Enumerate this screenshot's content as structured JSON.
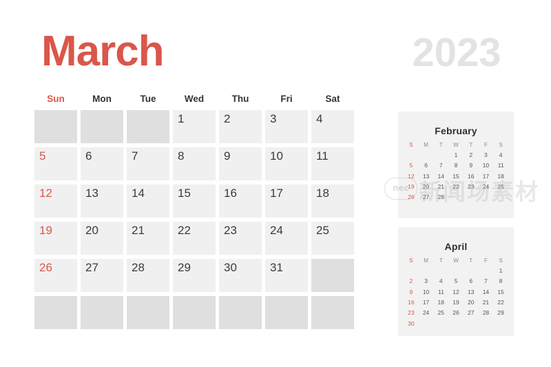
{
  "year": "2023",
  "month_title": "March",
  "colors": {
    "accent_red": "#d9574a",
    "text_dark": "#333333",
    "cell_filled": "#f0f0f0",
    "cell_empty": "#dfdfdf",
    "year_gray": "#e2e4e3",
    "mini_panel_bg": "#f2f2f2"
  },
  "main": {
    "weekdays": [
      "Sun",
      "Mon",
      "Tue",
      "Wed",
      "Thu",
      "Fri",
      "Sat"
    ],
    "weeks": [
      [
        "",
        "",
        "",
        "1",
        "2",
        "3",
        "4"
      ],
      [
        "5",
        "6",
        "7",
        "8",
        "9",
        "10",
        "11"
      ],
      [
        "12",
        "13",
        "14",
        "15",
        "16",
        "17",
        "18"
      ],
      [
        "19",
        "20",
        "21",
        "22",
        "23",
        "24",
        "25"
      ],
      [
        "26",
        "27",
        "28",
        "29",
        "30",
        "31",
        ""
      ],
      [
        "",
        "",
        "",
        "",
        "",
        "",
        ""
      ]
    ]
  },
  "mini_calendars": [
    {
      "title": "February",
      "weekdays": [
        "S",
        "M",
        "T",
        "W",
        "T",
        "F",
        "S"
      ],
      "weeks": [
        [
          "",
          "",
          "",
          "1",
          "2",
          "3",
          "4"
        ],
        [
          "5",
          "6",
          "7",
          "8",
          "9",
          "10",
          "11"
        ],
        [
          "12",
          "13",
          "14",
          "15",
          "16",
          "17",
          "18"
        ],
        [
          "19",
          "20",
          "21",
          "22",
          "23",
          "24",
          "25"
        ],
        [
          "26",
          "27",
          "28",
          "",
          "",
          "",
          ""
        ]
      ]
    },
    {
      "title": "April",
      "weekdays": [
        "S",
        "M",
        "T",
        "W",
        "T",
        "F",
        "S"
      ],
      "weeks": [
        [
          "",
          "",
          "",
          "",
          "",
          "",
          "1"
        ],
        [
          "2",
          "3",
          "4",
          "5",
          "6",
          "7",
          "8"
        ],
        [
          "9",
          "10",
          "11",
          "12",
          "13",
          "14",
          "15"
        ],
        [
          "16",
          "17",
          "18",
          "19",
          "20",
          "21",
          "22"
        ],
        [
          "23",
          "24",
          "25",
          "26",
          "27",
          "28",
          "29"
        ],
        [
          "30",
          "",
          "",
          "",
          "",
          "",
          ""
        ]
      ]
    }
  ],
  "watermark": {
    "badge": "nec",
    "text": "新闻场素材"
  }
}
